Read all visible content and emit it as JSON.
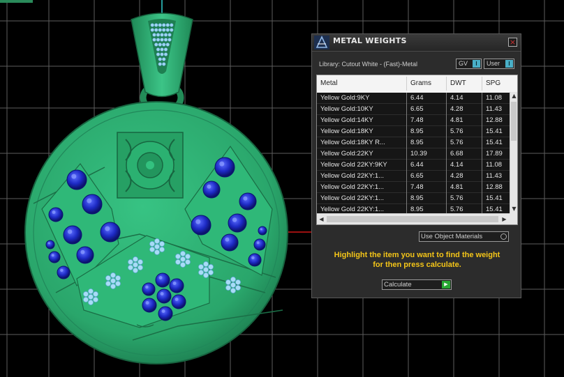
{
  "colors": {
    "background": "#000000",
    "grid": "#7a7a7a",
    "pendant_green": "#2eb373",
    "sapphire_blue": "#1a28b8",
    "diamond_light_blue": "#9fd3f2",
    "accent_yellow": "#f4c518"
  },
  "panel": {
    "title": "METAL WEIGHTS",
    "logo_icon": "anvil-logo-icon",
    "close_glyph": "×",
    "library_label": "Library: Cutout White - (Fast)-Metal",
    "toggle_gv": "GV",
    "toggle_user": "User",
    "toggle_knob_glyph": "I",
    "columns": [
      "Metal",
      "Grams",
      "DWT",
      "SPG"
    ],
    "rows": [
      [
        "Yellow Gold:9KY",
        "6.44",
        "4.14",
        "11.08"
      ],
      [
        "Yellow Gold:10KY",
        "6.65",
        "4.28",
        "11.43"
      ],
      [
        "Yellow Gold:14KY",
        "7.48",
        "4.81",
        "12.88"
      ],
      [
        "Yellow Gold:18KY",
        "8.95",
        "5.76",
        "15.41"
      ],
      [
        "Yellow Gold:18KY R...",
        "8.95",
        "5.76",
        "15.41"
      ],
      [
        "Yellow Gold:22KY",
        "10.39",
        "6.68",
        "17.89"
      ],
      [
        "Yellow Gold 22KY:9KY",
        "6.44",
        "4.14",
        "11.08"
      ],
      [
        "Yellow Gold 22KY:1...",
        "6.65",
        "4.28",
        "11.43"
      ],
      [
        "Yellow Gold 22KY:1...",
        "7.48",
        "4.81",
        "12.88"
      ],
      [
        "Yellow Gold 22KY:1...",
        "8.95",
        "5.76",
        "15.41"
      ],
      [
        "Yellow Gold 22KY:1...",
        "8.95",
        "5.76",
        "15.41"
      ]
    ],
    "scroll_up_glyph": "▲",
    "scroll_down_glyph": "▼",
    "scroll_left_glyph": "◀",
    "scroll_right_glyph": "▶",
    "use_object_materials": "Use Object Materials",
    "hint_line1": "Highlight the item you want to find the weight",
    "hint_line2": "for then press calculate.",
    "calculate_label": "Calculate",
    "calculate_icon": "play-icon",
    "play_glyph": "▶"
  }
}
